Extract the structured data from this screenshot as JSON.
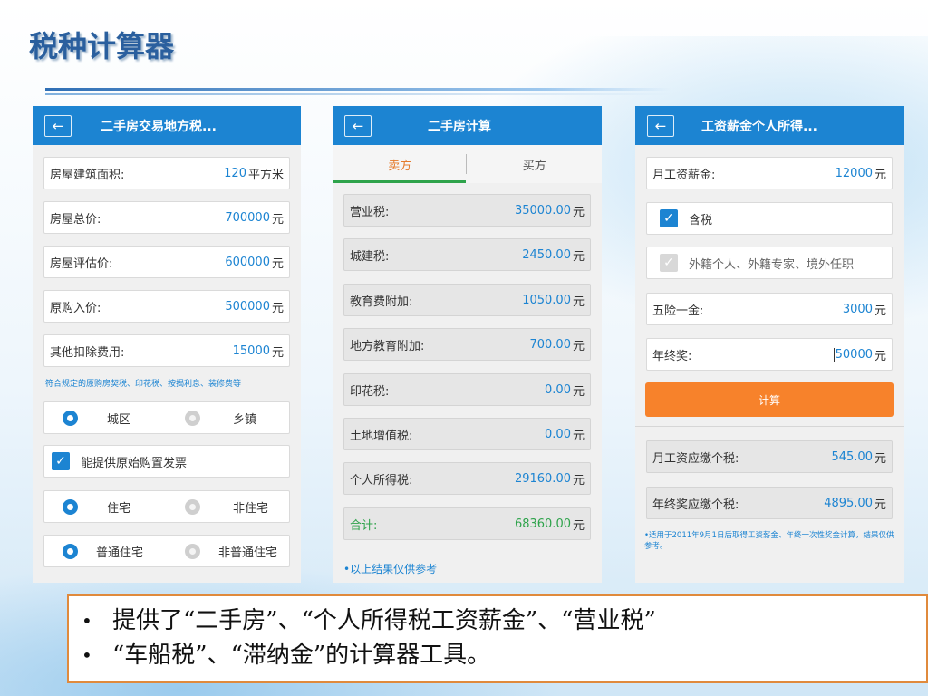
{
  "slide": {
    "title": "税种计算器"
  },
  "phone1": {
    "title": "二手房交易地方税...",
    "fields": [
      {
        "label": "房屋建筑面积:",
        "value": "120",
        "unit": "平方米"
      },
      {
        "label": "房屋总价:",
        "value": "700000",
        "unit": "元"
      },
      {
        "label": "房屋评估价:",
        "value": "600000",
        "unit": "元"
      },
      {
        "label": "原购入价:",
        "value": "500000",
        "unit": "元"
      },
      {
        "label": "其他扣除费用:",
        "value": "15000",
        "unit": "元"
      }
    ],
    "note": "符合规定的原购房契税、印花税、按揭利息、装修费等",
    "radio_location": {
      "selected": "城区",
      "other": "乡镇"
    },
    "checkbox_invoice": "能提供原始购置发票",
    "radio_type": {
      "selected": "住宅",
      "other": "非住宅"
    },
    "radio_grade": {
      "selected": "普通住宅",
      "other": "非普通住宅"
    }
  },
  "phone2": {
    "title": "二手房计算",
    "tabs": [
      "卖方",
      "买方"
    ],
    "active_tab": "卖方",
    "results": [
      {
        "label": "营业税:",
        "value": "35000.00",
        "unit": "元"
      },
      {
        "label": "城建税:",
        "value": "2450.00",
        "unit": "元"
      },
      {
        "label": "教育费附加:",
        "value": "1050.00",
        "unit": "元"
      },
      {
        "label": "地方教育附加:",
        "value": "700.00",
        "unit": "元"
      },
      {
        "label": "印花税:",
        "value": "0.00",
        "unit": "元"
      },
      {
        "label": "土地增值税:",
        "value": "0.00",
        "unit": "元"
      },
      {
        "label": "个人所得税:",
        "value": "29160.00",
        "unit": "元"
      }
    ],
    "total": {
      "label": "合计:",
      "value": "68360.00",
      "unit": "元"
    },
    "ref_note": "•以上结果仅供参考"
  },
  "phone3": {
    "title": "工资薪金个人所得...",
    "salary": {
      "label": "月工资薪金:",
      "value": "12000",
      "unit": "元"
    },
    "checkbox_tax": "含税",
    "checkbox_foreign": "外籍个人、外籍专家、境外任职",
    "insurance": {
      "label": "五险一金:",
      "value": "3000",
      "unit": "元"
    },
    "bonus": {
      "label": "年终奖:",
      "value": "50000",
      "unit": "元"
    },
    "calc_button": "计算",
    "monthly_tax": {
      "label": "月工资应缴个税:",
      "value": "545.00",
      "unit": "元"
    },
    "bonus_tax": {
      "label": "年终奖应缴个税:",
      "value": "4895.00",
      "unit": "元"
    },
    "note": "•适用于2011年9月1日后取得工资薪金、年终一次性奖金计算，结果仅供参考。"
  },
  "bullets": [
    "提供了“二手房”、“个人所得税工资薪金”、“营业税”",
    "“车船税”、“滞纳金”的计算器工具。"
  ],
  "colors": {
    "accent_blue": "#1c84d2",
    "accent_orange": "#f7822b",
    "tab_underline_green": "#2ea34b",
    "total_green": "#2ea34b",
    "title_blue": "#2a5f9e"
  },
  "icons": {
    "back": "arrow-left-icon",
    "check": "checkmark-icon"
  }
}
